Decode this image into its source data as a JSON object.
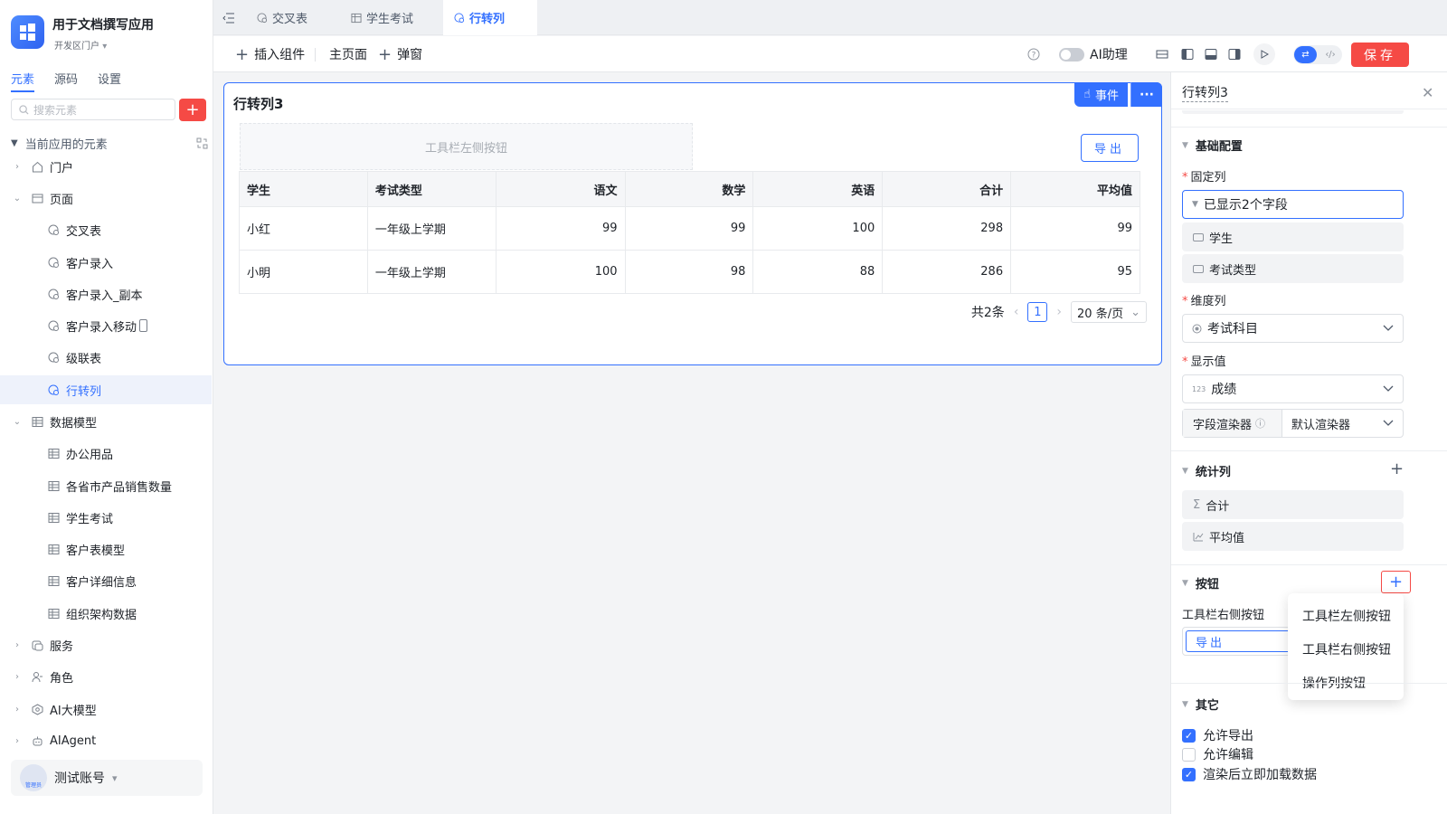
{
  "sidebar": {
    "app_name": "用于文档撰写应用",
    "app_env": "开发区门户",
    "tabs": [
      {
        "label": "元素"
      },
      {
        "label": "源码"
      },
      {
        "label": "设置"
      }
    ],
    "search_placeholder": "搜索元素",
    "tree_header": "当前应用的元素",
    "items": [
      {
        "label": "门户",
        "icon": "home-icon"
      },
      {
        "label": "页面",
        "icon": "page-icon"
      },
      {
        "label": "交叉表",
        "icon": "page-item-icon"
      },
      {
        "label": "客户录入",
        "icon": "page-item-icon"
      },
      {
        "label": "客户录入_副本",
        "icon": "page-item-icon"
      },
      {
        "label": "客户录入移动",
        "icon": "page-item-icon"
      },
      {
        "label": "级联表",
        "icon": "page-item-icon"
      },
      {
        "label": "行转列",
        "icon": "page-item-icon"
      },
      {
        "label": "数据模型",
        "icon": "table-icon"
      },
      {
        "label": "办公用品",
        "icon": "table-icon"
      },
      {
        "label": "各省市产品销售数量",
        "icon": "table-icon"
      },
      {
        "label": "学生考试",
        "icon": "table-icon"
      },
      {
        "label": "客户表模型",
        "icon": "table-icon"
      },
      {
        "label": "客户详细信息",
        "icon": "table-icon"
      },
      {
        "label": "组织架构数据",
        "icon": "table-icon"
      },
      {
        "label": "服务",
        "icon": "service-icon"
      },
      {
        "label": "角色",
        "icon": "role-icon"
      },
      {
        "label": "AI大模型",
        "icon": "ai-model-icon"
      },
      {
        "label": "AIAgent",
        "icon": "robot-icon"
      }
    ],
    "account_name": "测试账号",
    "account_role": "管理员"
  },
  "tabs": [
    {
      "label": "交叉表"
    },
    {
      "label": "学生考试"
    },
    {
      "label": "行转列"
    }
  ],
  "toolbar": {
    "insert_component": "插入组件",
    "home_page": "主页面",
    "popup": "弹窗",
    "ai_assistant": "AI助理",
    "save": "保存"
  },
  "component": {
    "title": "行转列3",
    "event_btn": "事件",
    "left_toolbar_placeholder": "工具栏左侧按钮",
    "export_btn": "导出",
    "columns": [
      "学生",
      "考试类型",
      "语文",
      "数学",
      "英语",
      "合计",
      "平均值"
    ],
    "rows": [
      [
        "小红",
        "一年级上学期",
        "99",
        "99",
        "100",
        "298",
        "99"
      ],
      [
        "小明",
        "一年级上学期",
        "100",
        "98",
        "88",
        "286",
        "95"
      ]
    ],
    "pager": {
      "total": "共2条",
      "current": "1",
      "page_size": "20 条/页"
    }
  },
  "panel": {
    "title": "行转列3",
    "basic_section": "基础配置",
    "fixed_col_label": "固定列",
    "fixed_col_value": "已显示2个字段",
    "fixed_fields": [
      "学生",
      "考试类型"
    ],
    "dimension_label": "维度列",
    "dimension_value": "考试科目",
    "display_label": "显示值",
    "display_value": "成绩",
    "renderer_label": "字段渲染器",
    "renderer_value": "默认渲染器",
    "stat_section": "统计列",
    "stat_items": [
      "合计",
      "平均值"
    ],
    "button_section": "按钮",
    "right_toolbar_label": "工具栏右侧按钮",
    "right_toolbar_value": "导出",
    "dropdown": [
      "工具栏左侧按钮",
      "工具栏右侧按钮",
      "操作列按钮"
    ],
    "other_section": "其它",
    "options": [
      {
        "label": "允许导出",
        "checked": true
      },
      {
        "label": "允许编辑",
        "checked": false
      },
      {
        "label": "渲染后立即加载数据",
        "checked": true
      }
    ]
  },
  "colors": {
    "accent": "#3370ff",
    "danger": "#f54a45"
  }
}
